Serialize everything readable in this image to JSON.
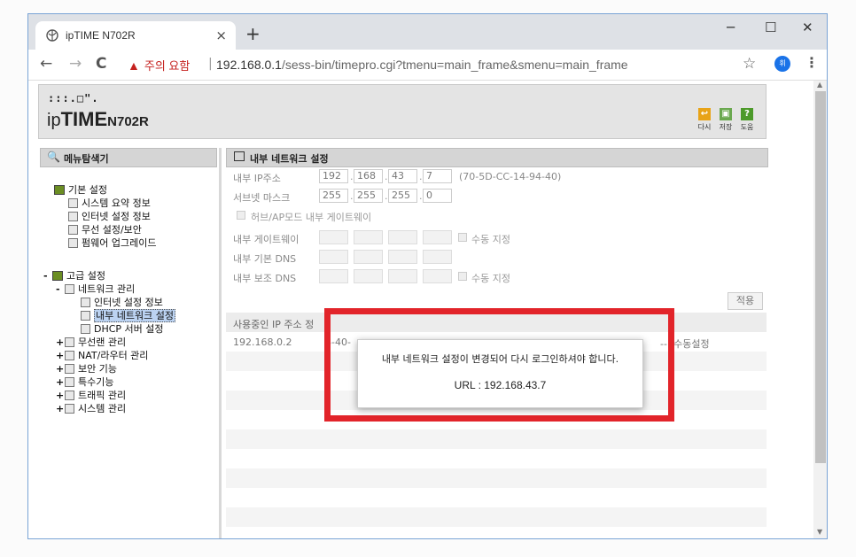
{
  "browser": {
    "tab_title": "ipTIME N702R",
    "tab_close": "×",
    "new_tab": "+",
    "win_min": "─",
    "win_max": "☐",
    "win_close": "✕",
    "back": "←",
    "forward": "→",
    "reload": "C",
    "security_warning": "주의 요함",
    "separator": "|",
    "url_host": "192.168.0.1",
    "url_path": "/sess-bin/timepro.cgi?tmenu=main_frame&smenu=main_frame",
    "bookmark_star": "☆",
    "profile_initial": "휘",
    "menu": "⋮"
  },
  "header": {
    "logo_dots": ":::.□\".",
    "logo_ip": "ip",
    "logo_time": "TIME",
    "logo_model": "N702R",
    "buttons": [
      {
        "label": "다시",
        "icon": "undo-icon",
        "color": "#e8a317"
      },
      {
        "label": "저장",
        "icon": "save-icon",
        "color": "#6aa84f"
      },
      {
        "label": "도움",
        "icon": "help-icon",
        "glyph": "?",
        "color": "#4c9a2a"
      }
    ]
  },
  "sidebar": {
    "title": "메뉴탐색기",
    "basic": {
      "label": "기본 설정",
      "items": [
        "시스템 요약 정보",
        "인터넷 설정 정보",
        "무선 설정/보안",
        "펌웨어 업그레이드"
      ]
    },
    "advanced": {
      "toggle": "-",
      "label": "고급 설정",
      "network": {
        "toggle": "-",
        "label": "네트워크 관리",
        "items": [
          "인터넷 설정 정보",
          "내부 네트워크 설정",
          "DHCP 서버 설정"
        ]
      },
      "others": [
        {
          "toggle": "+",
          "label": "무선랜 관리"
        },
        {
          "toggle": "+",
          "label": "NAT/라우터 관리"
        },
        {
          "toggle": "+",
          "label": "보안 기능"
        },
        {
          "toggle": "+",
          "label": "특수기능"
        },
        {
          "toggle": "+",
          "label": "트래픽 관리"
        },
        {
          "toggle": "+",
          "label": "시스템 관리"
        }
      ]
    }
  },
  "content": {
    "title": "내부 네트워크 설정",
    "ip_label": "내부 IP주소",
    "ip": [
      "192",
      "168",
      "43",
      "7"
    ],
    "mac": "(70-5D-CC-14-94-40)",
    "mask_label": "서브넷 마스크",
    "mask": [
      "255",
      "255",
      "255",
      "0"
    ],
    "hub_mode": "허브/AP모드 내부 게이트웨이",
    "gateway_label": "내부 게이트웨이",
    "dns1_label": "내부 기본 DNS",
    "dns2_label": "내부 보조 DNS",
    "manual_label": "수동 지정",
    "apply": "적용",
    "lease_header": "사용중인 IP 주소 정",
    "lease": [
      {
        "ip": "192.168.0.2",
        "mac": "8-40-",
        "status": "-- :수동설정"
      }
    ]
  },
  "dialog": {
    "message": "내부 네트워크 설정이 변경되어 다시 로그인하셔야 합니다.",
    "url": "URL : 192.168.43.7",
    "highlight_color": "#e2242a"
  }
}
